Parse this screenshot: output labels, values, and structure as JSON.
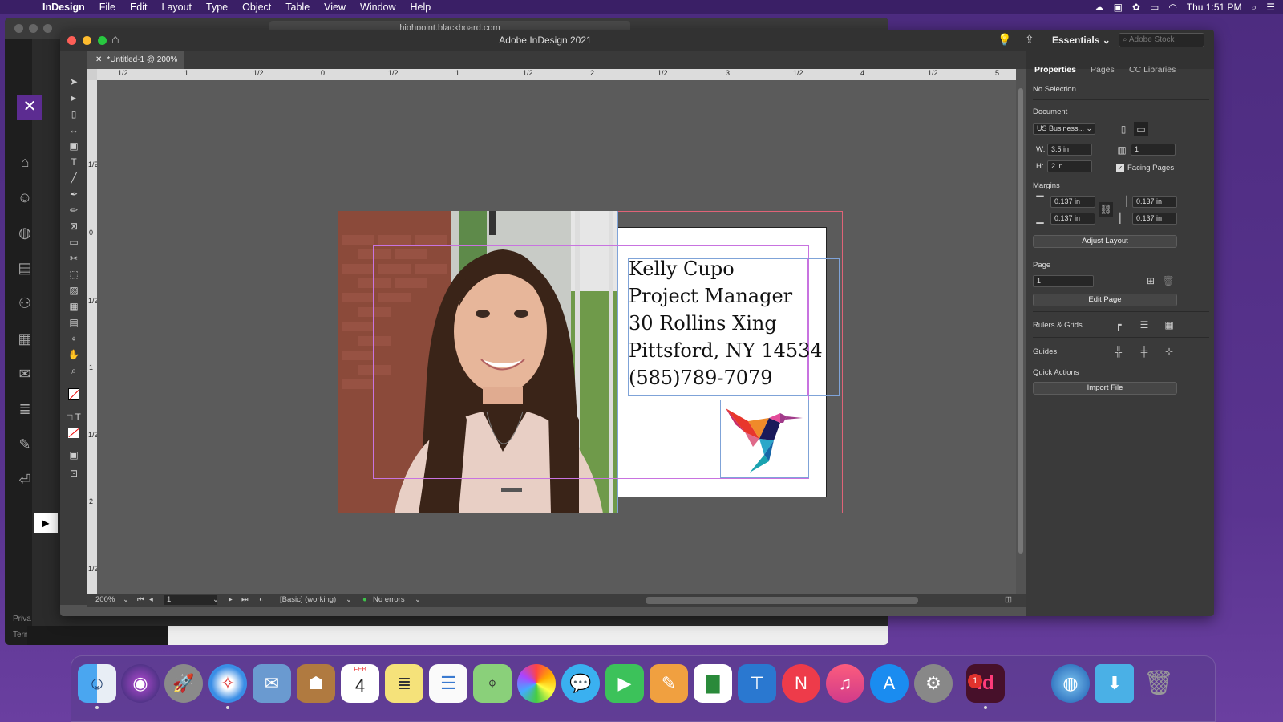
{
  "menubar": {
    "app_name": "InDesign",
    "items": [
      "File",
      "Edit",
      "Layout",
      "Type",
      "Object",
      "Table",
      "View",
      "Window",
      "Help"
    ],
    "clock": "Thu 1:51 PM"
  },
  "browser": {
    "url": "highpoint.blackboard.com",
    "footer_1": "Priva",
    "footer_2": "Term"
  },
  "indesign": {
    "window_title": "Adobe InDesign 2021",
    "workspace": "Essentials",
    "stock_placeholder": "Adobe Stock",
    "doc_tab": "*Untitled-1 @ 200%",
    "ruler_h_labels": [
      "1/2",
      "1",
      "1/2",
      "0",
      "1/2",
      "1",
      "1/2",
      "2",
      "1/2",
      "3",
      "1/2",
      "4",
      "1/2",
      "5"
    ],
    "ruler_v_labels": [
      "1/2",
      "0",
      "1/2",
      "1",
      "1/2",
      "2",
      "1/2"
    ],
    "status": {
      "zoom": "200%",
      "page": "1",
      "style": "[Basic] (working)",
      "preflight": "No errors"
    }
  },
  "card": {
    "name": "Kelly Cupo",
    "title": "Project Manager",
    "street": "30 Rollins Xing",
    "city": "Pittsford, NY 14534",
    "phone": "(585)789-7079"
  },
  "panel": {
    "tabs": [
      "Properties",
      "Pages",
      "CC Libraries"
    ],
    "selection": "No Selection",
    "document_label": "Document",
    "preset": "US Business...",
    "width_label": "W:",
    "width": "3.5 in",
    "height_label": "H:",
    "height": "2 in",
    "pages_count": "1",
    "facing_pages": "Facing Pages",
    "margins_label": "Margins",
    "margin_top": "0.137 in",
    "margin_bottom": "0.137 in",
    "margin_inside": "0.137 in",
    "margin_outside": "0.137 in",
    "adjust_layout": "Adjust Layout",
    "page_label": "Page",
    "page_value": "1",
    "edit_page": "Edit Page",
    "rulers_grids": "Rulers & Grids",
    "guides": "Guides",
    "quick_actions": "Quick Actions",
    "import_file": "Import File"
  },
  "dock": {
    "calendar_month": "FEB",
    "calendar_day": "4",
    "indesign_label": "Id",
    "badge_count": "1"
  }
}
